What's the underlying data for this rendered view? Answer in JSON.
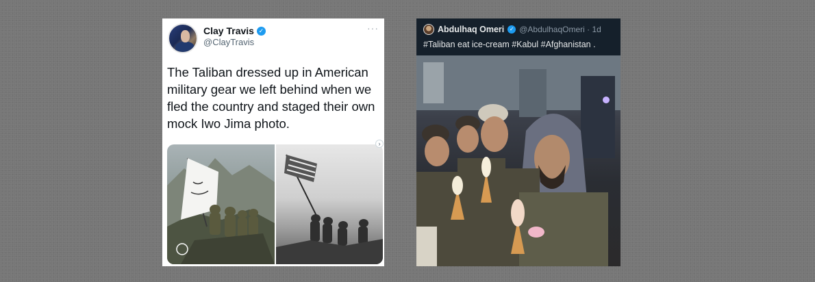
{
  "tweet_left": {
    "name": "Clay Travis",
    "handle": "@ClayTravis",
    "more_icon": "ellipsis-icon",
    "verified_icon": "verified-badge-icon",
    "text_lines": [
      "The Taliban dressed up in American",
      "military gear we left behind when we",
      "fled the country and staged their own",
      "mock Iwo Jima photo."
    ],
    "media": [
      {
        "alt": "Taliban fighters raising white flag in military gear on rocky hill"
      },
      {
        "alt": "Black-and-white Iwo Jima flag raising photo"
      }
    ],
    "next_icon": "chevron-right-icon"
  },
  "tweet_right": {
    "name": "Abdulhaq Omeri",
    "handle_time": "@AbdulhaqOmeri · 1d",
    "verified_icon": "verified-badge-icon",
    "text": "#Taliban eat ice-cream #Kabul #Afghanistan .",
    "media_alt": "Men holding ice-cream cones on a street at night"
  },
  "colors": {
    "background": "#767676",
    "twitter_blue": "#1d9bf0",
    "dark_card": "#15202b"
  }
}
